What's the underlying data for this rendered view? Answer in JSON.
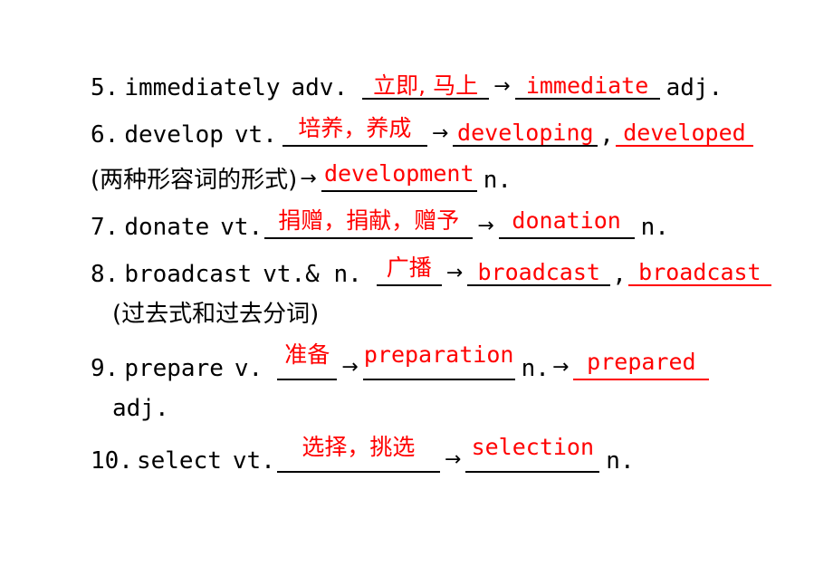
{
  "page": {
    "background": "#ffffff",
    "ink_black": "#000000",
    "ink_red": "#ff0000"
  },
  "entries": [
    {
      "number": "5.",
      "word": "immediately",
      "pos": "adv.",
      "meaning_cn": "立即, 马上",
      "arrow": "→",
      "derived": "immediate",
      "derived_pos": "adj."
    },
    {
      "number": "6.",
      "word": "develop",
      "pos": "vt.",
      "meaning_cn": "培养，养成",
      "arrow": "→",
      "derived_1": "developing",
      "comma": ",",
      "derived_2": "developed",
      "note_cn": "(两种形容词的形式)",
      "note_arrow": "→",
      "note_derived": "development",
      "note_pos": "n."
    },
    {
      "number": "7.",
      "word": "donate",
      "pos": "vt.",
      "meaning_cn": "捐赠，捐献，赠予",
      "arrow": "→",
      "derived": "donation",
      "derived_pos": "n."
    },
    {
      "number": "8.",
      "word": "broadcast",
      "pos": "vt.& n.",
      "meaning_cn": "广播",
      "arrow": "→",
      "derived_1": "broadcast",
      "comma": ",",
      "derived_2": "broadcast",
      "note_cn": "(过去式和过去分词)"
    },
    {
      "number": "9.",
      "word": "prepare",
      "pos": "v.",
      "meaning_cn": "准备",
      "arrow_1": "→",
      "derived_1": "preparation",
      "derived_1_pos": "n.",
      "arrow_2": "→",
      "derived_2": "prepared",
      "derived_2_pos": "adj."
    },
    {
      "number": "10.",
      "word": "select",
      "pos": "vt.",
      "meaning_cn": "选择，挑选",
      "arrow": "→",
      "derived": "selection",
      "derived_pos": "n."
    }
  ]
}
